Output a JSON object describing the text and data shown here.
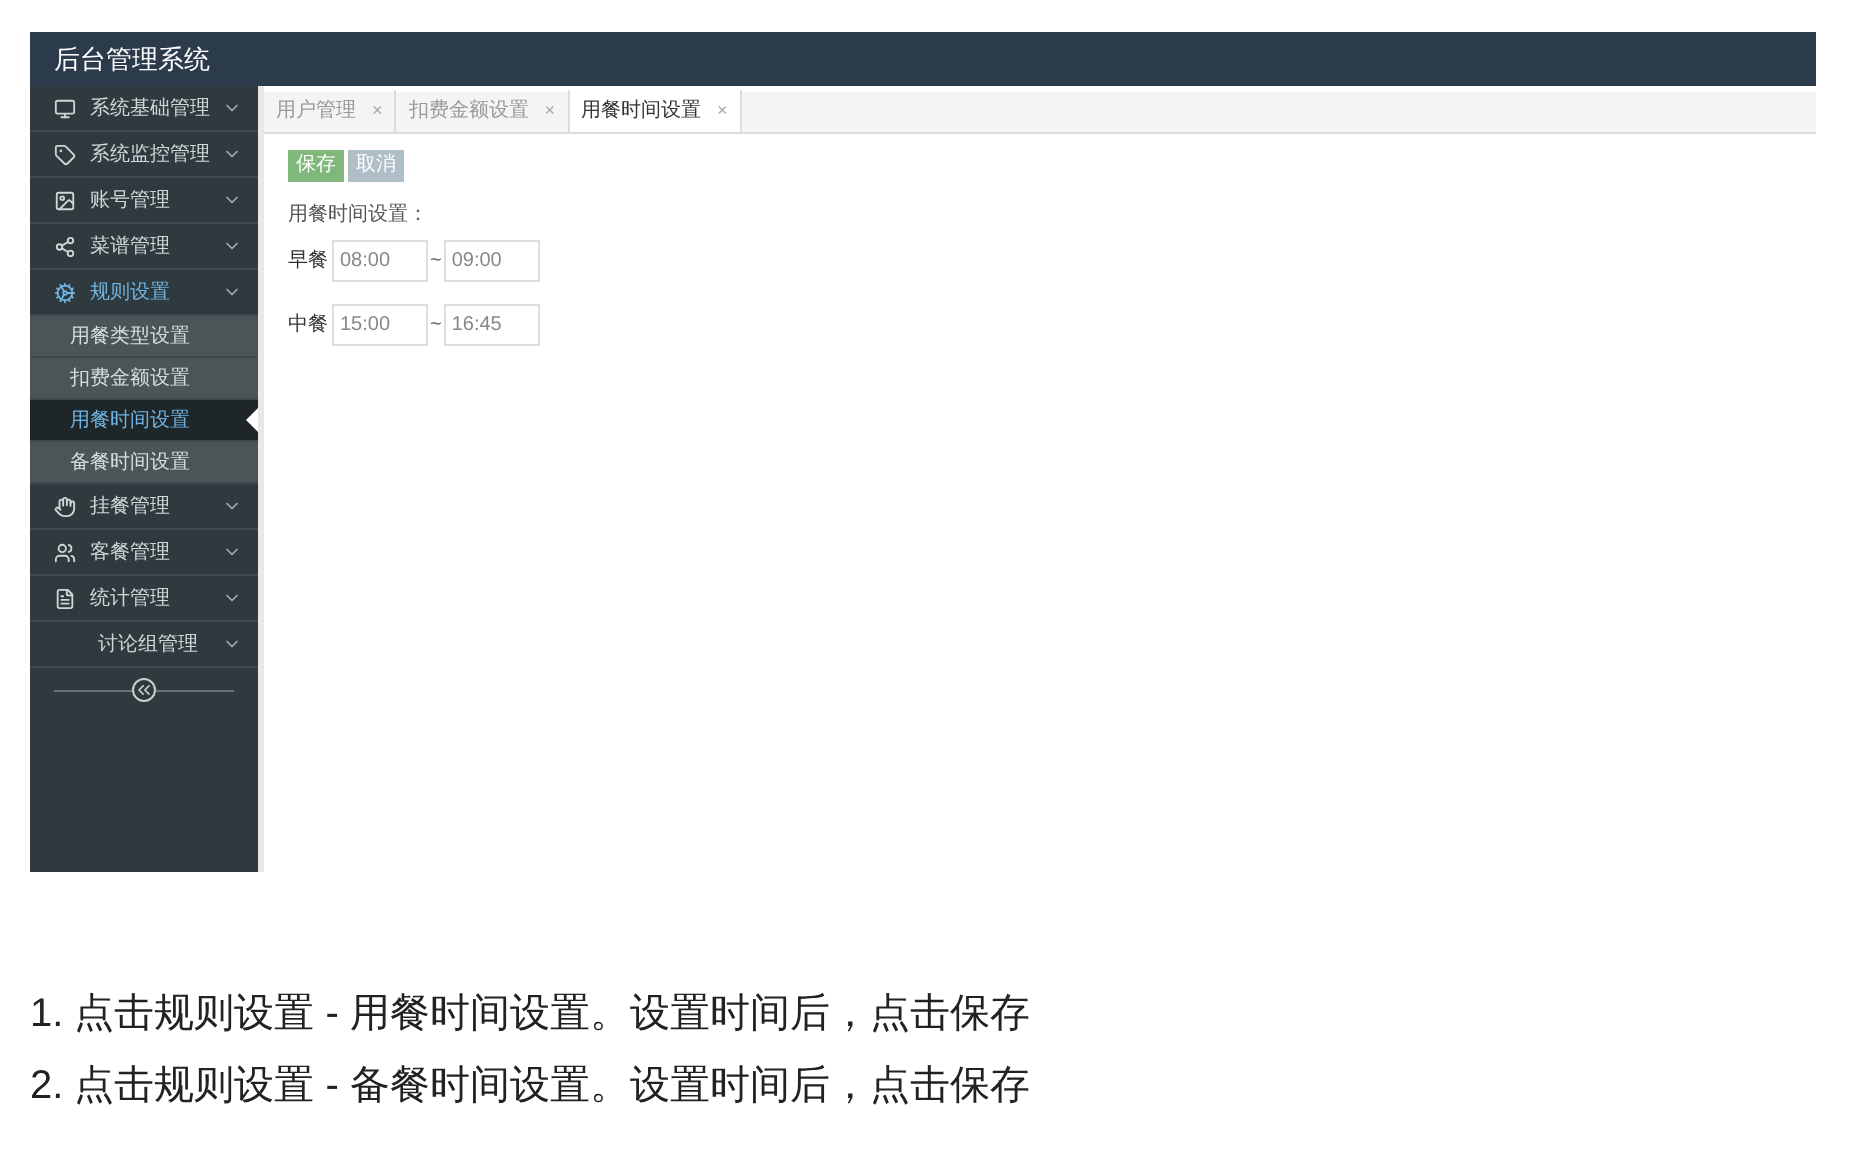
{
  "header": {
    "title": "后台管理系统"
  },
  "sidebar": {
    "items": [
      {
        "label": "系统基础管理",
        "expanded": false
      },
      {
        "label": "系统监控管理",
        "expanded": false
      },
      {
        "label": "账号管理",
        "expanded": false
      },
      {
        "label": "菜谱管理",
        "expanded": false
      },
      {
        "label": "规则设置",
        "expanded": true,
        "children": [
          {
            "label": "用餐类型设置",
            "selected": false
          },
          {
            "label": "扣费金额设置",
            "selected": false
          },
          {
            "label": "用餐时间设置",
            "selected": true
          },
          {
            "label": "备餐时间设置",
            "selected": false
          }
        ]
      },
      {
        "label": "挂餐管理",
        "expanded": false
      },
      {
        "label": "客餐管理",
        "expanded": false
      },
      {
        "label": "统计管理",
        "expanded": false
      },
      {
        "label": "讨论组管理",
        "expanded": false
      }
    ]
  },
  "tabs": [
    {
      "label": "用户管理",
      "close": "×",
      "selected": false
    },
    {
      "label": "扣费金额设置",
      "close": "×",
      "selected": false
    },
    {
      "label": "用餐时间设置",
      "close": "×",
      "selected": true
    }
  ],
  "toolbar": {
    "buttons": [
      {
        "label": "保存",
        "kind": "primary"
      },
      {
        "label": "取消",
        "kind": "secondary"
      }
    ]
  },
  "form": {
    "title": "用餐时间设置：",
    "rows": [
      {
        "label": "早餐",
        "from": "08:00",
        "sep": "~",
        "to": "09:00"
      },
      {
        "label": "中餐",
        "from": "15:00",
        "sep": "~",
        "to": "16:45"
      }
    ]
  },
  "captions": [
    "1. 点击规则设置 - 用餐时间设置。设置时间后，点击保存",
    "2. 点击规则设置 - 备餐时间设置。设置时间后，点击保存"
  ]
}
